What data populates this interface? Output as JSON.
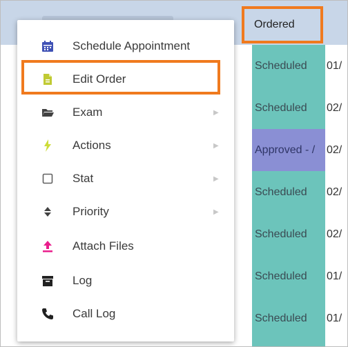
{
  "column_header": {
    "label": "Ordered"
  },
  "rows": [
    {
      "status": "Scheduled",
      "date": "01/"
    },
    {
      "status": "Scheduled",
      "date": "02/"
    },
    {
      "status": "Approved - /",
      "date": "02/"
    },
    {
      "status": "Scheduled",
      "date": "02/"
    },
    {
      "status": "Scheduled",
      "date": "02/"
    },
    {
      "status": "Scheduled",
      "date": "01/"
    },
    {
      "status": "Scheduled",
      "date": "01/"
    }
  ],
  "context_menu": {
    "items": [
      {
        "label": "Schedule Appointment",
        "icon": "calendar-icon",
        "color": "#3f51b5"
      },
      {
        "label": "Edit Order",
        "icon": "document-edit-icon",
        "color": "#c0ca33"
      },
      {
        "label": "Exam",
        "icon": "folder-open-icon",
        "color": "#424242"
      },
      {
        "label": "Actions",
        "icon": "lightning-icon",
        "color": "#cddc39"
      },
      {
        "label": "Stat",
        "icon": "checkbox-icon",
        "color": "#616161"
      },
      {
        "label": "Priority",
        "icon": "sort-icon",
        "color": "#424242"
      },
      {
        "label": "Attach Files",
        "icon": "upload-icon",
        "color": "#e91e8c"
      },
      {
        "label": "Log",
        "icon": "archive-icon",
        "color": "#212121"
      },
      {
        "label": "Call Log",
        "icon": "phone-icon",
        "color": "#212121"
      }
    ]
  },
  "colors": {
    "highlight": "#f07a1e",
    "scheduled": "#6cc4bb",
    "approved": "#8a8fd4",
    "header": "#c8d6e8"
  }
}
